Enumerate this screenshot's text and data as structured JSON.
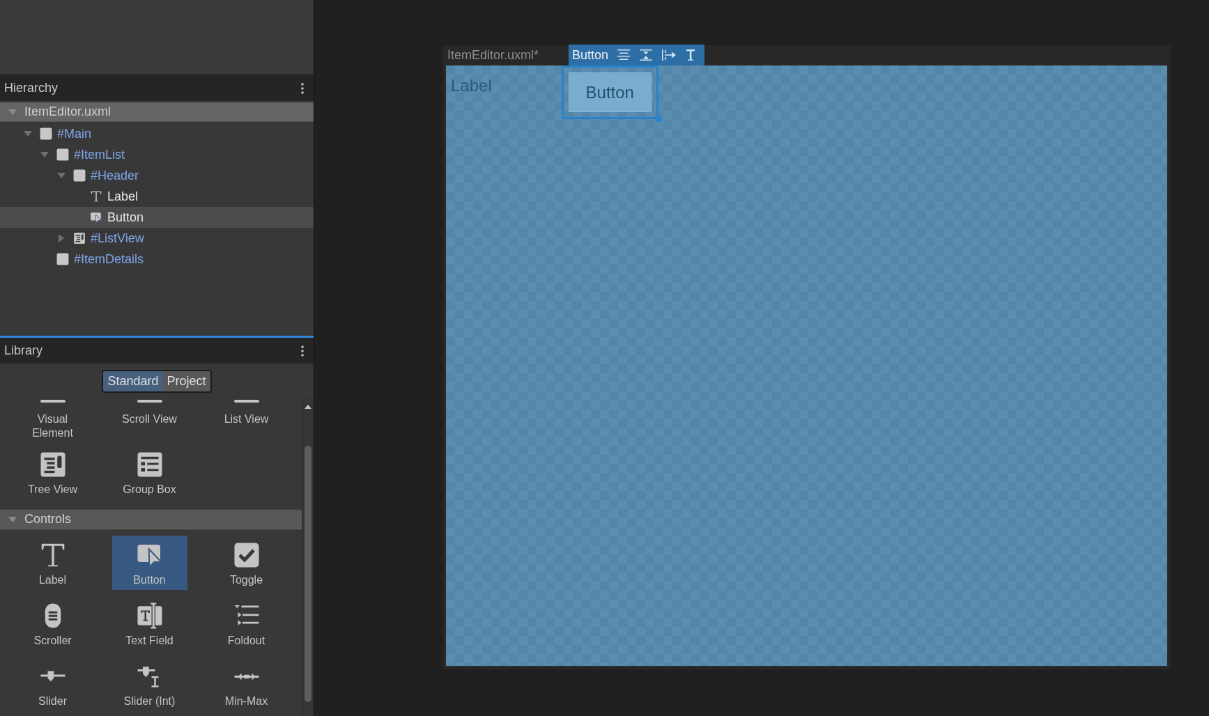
{
  "hierarchy": {
    "title": "Hierarchy",
    "tree": [
      {
        "label": "ItemEditor.uxml",
        "kind": "document",
        "expanded": true,
        "selected": false,
        "children": [
          {
            "label": "#Main",
            "kind": "element",
            "expanded": true,
            "selected": false,
            "children": [
              {
                "label": "#ItemList",
                "kind": "element",
                "expanded": true,
                "selected": false,
                "children": [
                  {
                    "label": "#Header",
                    "kind": "element",
                    "expanded": true,
                    "selected": false,
                    "children": [
                      {
                        "label": "Label",
                        "kind": "label",
                        "selected": false
                      },
                      {
                        "label": "Button",
                        "kind": "button",
                        "selected": true
                      }
                    ]
                  },
                  {
                    "label": "#ListView",
                    "kind": "list-view",
                    "expanded": false,
                    "selected": false
                  }
                ]
              },
              {
                "label": "#ItemDetails",
                "kind": "element",
                "selected": false
              }
            ]
          }
        ]
      }
    ]
  },
  "library": {
    "title": "Library",
    "tabs": [
      {
        "label": "Standard",
        "selected": true
      },
      {
        "label": "Project",
        "selected": false
      }
    ],
    "sections": [
      {
        "items": [
          {
            "label": "Visual Element",
            "kind": "cut",
            "selected": false
          },
          {
            "label": "Scroll View",
            "kind": "cut",
            "selected": false
          },
          {
            "label": "List View",
            "kind": "cut",
            "selected": false
          },
          {
            "label": "Tree View",
            "kind": "tree-view",
            "selected": false
          },
          {
            "label": "Group Box",
            "kind": "group-box",
            "selected": false
          }
        ]
      },
      {
        "title": "Controls",
        "expanded": true,
        "items": [
          {
            "label": "Label",
            "kind": "label",
            "selected": false
          },
          {
            "label": "Button",
            "kind": "button",
            "selected": true
          },
          {
            "label": "Toggle",
            "kind": "toggle",
            "selected": false
          },
          {
            "label": "Scroller",
            "kind": "scroller",
            "selected": false
          },
          {
            "label": "Text Field",
            "kind": "text-field",
            "selected": false
          },
          {
            "label": "Foldout",
            "kind": "foldout",
            "selected": false
          },
          {
            "label": "Slider",
            "kind": "slider",
            "selected": false
          },
          {
            "label": "Slider (Int)",
            "kind": "slider-int",
            "selected": false
          },
          {
            "label": "Min-Max",
            "kind": "min-max",
            "selected": false
          }
        ]
      }
    ]
  },
  "canvas": {
    "title": "ItemEditor.uxml*",
    "selection_toolbar": {
      "label": "Button"
    },
    "elements": [
      {
        "kind": "label",
        "text": "Label",
        "selected": false
      },
      {
        "kind": "button",
        "text": "Button",
        "selected": true
      }
    ]
  }
}
